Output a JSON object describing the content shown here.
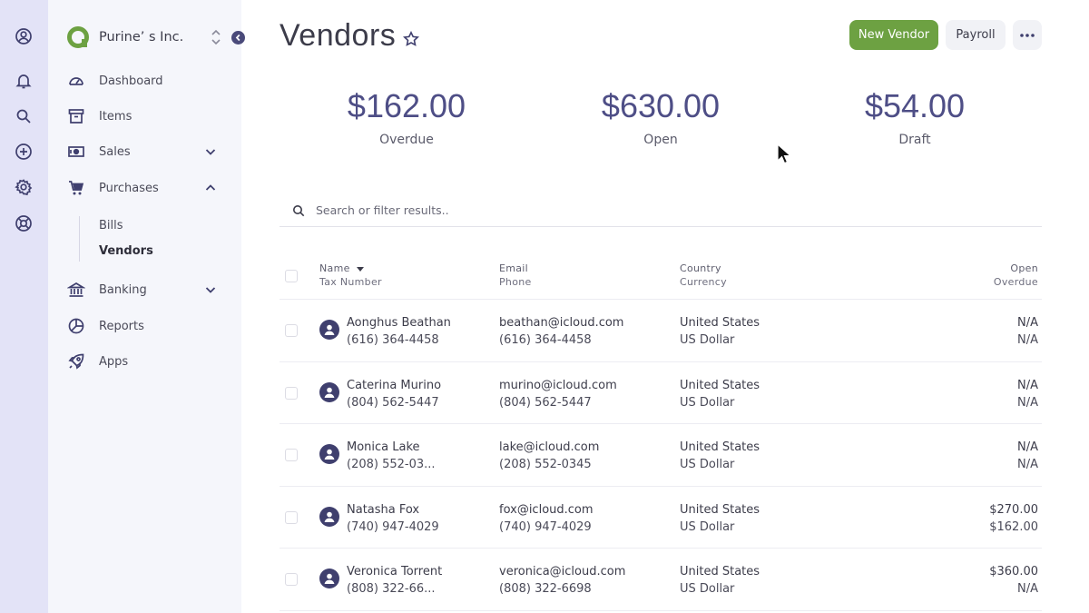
{
  "icons": {
    "rail": [
      "user-circle-icon",
      "bell-icon",
      "search-icon",
      "plus-circle-icon",
      "gear-icon",
      "lifebuoy-icon"
    ],
    "nav": [
      "gauge-icon",
      "archive-icon",
      "banknote-icon",
      "cart-icon",
      "bank-icon",
      "chart-pie-icon",
      "rocket-icon"
    ]
  },
  "colors": {
    "accent_green": "#6da142",
    "amount_purple": "#4e4e86",
    "avatar": "#3f3f6e",
    "rail_bg": "#e3e3f7",
    "sidebar_bg": "#f5f6fb"
  },
  "sidebar": {
    "brand": "Purine’ s Inc.",
    "nav": {
      "dashboard": "Dashboard",
      "items": "Items",
      "sales": "Sales",
      "purchases": "Purchases",
      "bills": "Bills",
      "vendors": "Vendors",
      "banking": "Banking",
      "reports": "Reports",
      "apps": "Apps"
    }
  },
  "header": {
    "title": "Vendors",
    "new_vendor": "New Vendor",
    "payroll": "Payroll"
  },
  "summary": [
    {
      "amount": "$162.00",
      "label": "Overdue"
    },
    {
      "amount": "$630.00",
      "label": "Open"
    },
    {
      "amount": "$54.00",
      "label": "Draft"
    }
  ],
  "search": {
    "placeholder": "Search or filter results.."
  },
  "table": {
    "headers": {
      "name": "Name",
      "tax_number": "Tax Number",
      "email": "Email",
      "phone": "Phone",
      "country": "Country",
      "currency": "Currency",
      "open": "Open",
      "overdue": "Overdue"
    },
    "rows": [
      {
        "name": "Aonghus Beathan",
        "tax": "(616) 364-4458",
        "email": "beathan@icloud.com",
        "phone": "(616) 364-4458",
        "country": "United States",
        "currency": "US Dollar",
        "open": "N/A",
        "overdue": "N/A"
      },
      {
        "name": "Caterina Murino",
        "tax": "(804) 562-5447",
        "email": "murino@icloud.com",
        "phone": "(804) 562-5447",
        "country": "United States",
        "currency": "US Dollar",
        "open": "N/A",
        "overdue": "N/A"
      },
      {
        "name": "Monica Lake",
        "tax": "(208) 552-03...",
        "email": "lake@icloud.com",
        "phone": "(208) 552-0345",
        "country": "United States",
        "currency": "US Dollar",
        "open": "N/A",
        "overdue": "N/A"
      },
      {
        "name": "Natasha Fox",
        "tax": "(740) 947-4029",
        "email": "fox@icloud.com",
        "phone": "(740) 947-4029",
        "country": "United States",
        "currency": "US Dollar",
        "open": "$270.00",
        "overdue": "$162.00"
      },
      {
        "name": "Veronica Torrent",
        "tax": "(808) 322-66...",
        "email": "veronica@icloud.com",
        "phone": "(808) 322-6698",
        "country": "United States",
        "currency": "US Dollar",
        "open": "$360.00",
        "overdue": "N/A"
      }
    ]
  }
}
